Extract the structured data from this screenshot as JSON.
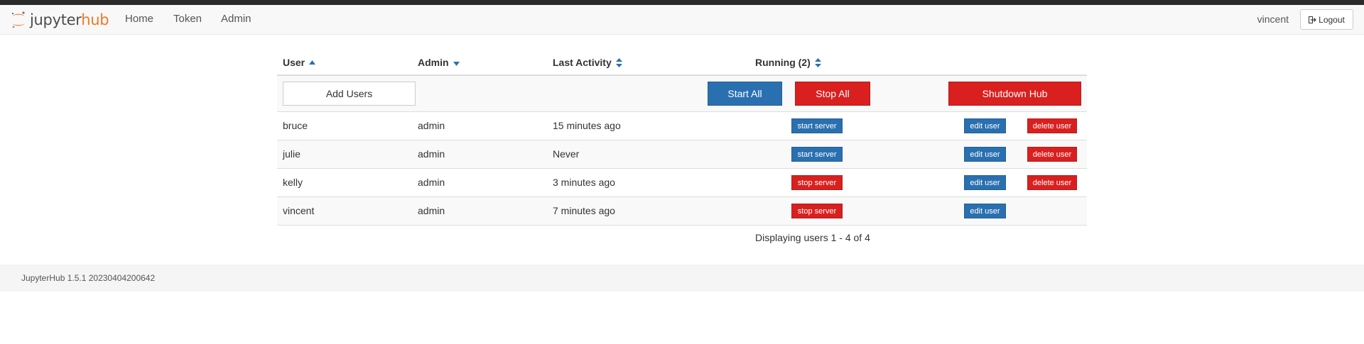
{
  "navbar": {
    "brand_part1": "jupyter",
    "brand_part2": "hub",
    "links": [
      "Home",
      "Token",
      "Admin"
    ],
    "username": "vincent",
    "logout_label": "Logout"
  },
  "table": {
    "columns": {
      "user": "User",
      "admin": "Admin",
      "last_activity": "Last Activity",
      "running": "Running (2)"
    },
    "actions": {
      "add_users": "Add Users",
      "start_all": "Start All",
      "stop_all": "Stop All",
      "shutdown_hub": "Shutdown Hub"
    },
    "rows": [
      {
        "user": "bruce",
        "admin": "admin",
        "last_activity": "15 minutes ago",
        "server_action": "start server",
        "edit": "edit user",
        "delete": "delete user"
      },
      {
        "user": "julie",
        "admin": "admin",
        "last_activity": "Never",
        "server_action": "start server",
        "edit": "edit user",
        "delete": "delete user"
      },
      {
        "user": "kelly",
        "admin": "admin",
        "last_activity": "3 minutes ago",
        "server_action": "stop server",
        "edit": "edit user",
        "delete": "delete user"
      },
      {
        "user": "vincent",
        "admin": "admin",
        "last_activity": "7 minutes ago",
        "server_action": "stop server",
        "edit": "edit user"
      }
    ],
    "pagination_text": "Displaying users 1 - 4 of 4"
  },
  "footer": {
    "version_text": "JupyterHub 1.5.1 20230404200642"
  },
  "colors": {
    "primary": "#2a70b0",
    "danger": "#d9201f",
    "brand_orange": "#f37726"
  }
}
